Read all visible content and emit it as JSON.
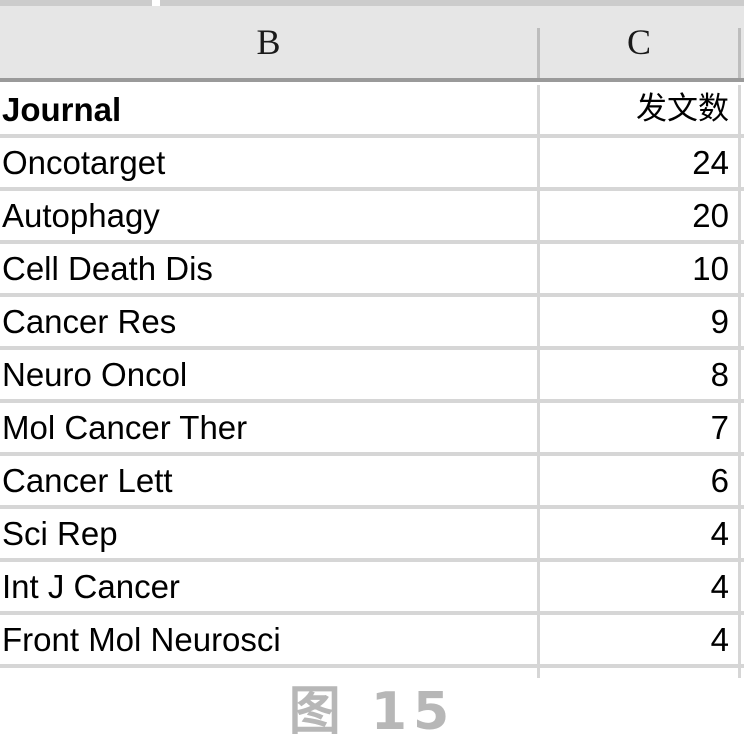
{
  "spreadsheet": {
    "column_headers": [
      {
        "id": "col-b",
        "label": "B"
      },
      {
        "id": "col-c",
        "label": "C"
      }
    ],
    "header_row": {
      "journal": "Journal",
      "count": "发文数"
    },
    "rows": [
      {
        "journal": "Oncotarget",
        "count": "24"
      },
      {
        "journal": "Autophagy",
        "count": "20"
      },
      {
        "journal": "Cell Death Dis",
        "count": "10"
      },
      {
        "journal": "Cancer Res",
        "count": "9"
      },
      {
        "journal": "Neuro Oncol",
        "count": "8"
      },
      {
        "journal": "Mol Cancer Ther",
        "count": "7"
      },
      {
        "journal": "Cancer Lett",
        "count": "6"
      },
      {
        "journal": "Sci Rep",
        "count": "4"
      },
      {
        "journal": "Int J Cancer",
        "count": "4"
      },
      {
        "journal": "Front Mol Neurosci",
        "count": "4"
      }
    ]
  },
  "caption": {
    "text": "图 15"
  },
  "colors": {
    "header_band": "#e6e6e6",
    "header_rule": "#9a9a9a",
    "grid_line": "#d6d6d6",
    "top_strip": "#cccccc",
    "cell_text": "#000000",
    "caption_text": "#b7b7b7",
    "background": "#ffffff"
  }
}
